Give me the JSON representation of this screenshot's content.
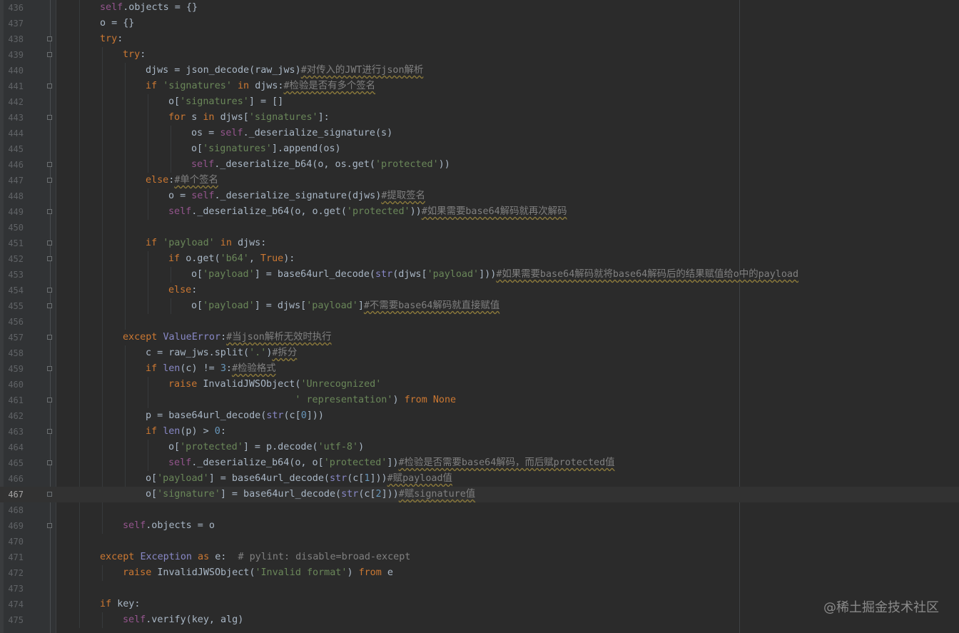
{
  "theme": {
    "background": "#2b2b2b",
    "gutter": "#313335",
    "keyword": "#cc7832",
    "string": "#6a8759",
    "number": "#6897bb",
    "comment": "#808080",
    "self": "#94558d",
    "builtin_class": "#8888c6",
    "text": "#a9b7c6"
  },
  "editor": {
    "current_line": "467",
    "lines": [
      {
        "num": "436",
        "indent": 2,
        "fold": false,
        "tokens": [
          [
            "self",
            "self"
          ],
          [
            "",
            ".objects = {}"
          ]
        ]
      },
      {
        "num": "437",
        "indent": 2,
        "fold": false,
        "tokens": [
          [
            "",
            "o = {}"
          ]
        ]
      },
      {
        "num": "438",
        "indent": 2,
        "fold": true,
        "tokens": [
          [
            "k",
            "try"
          ],
          [
            "",
            ":"
          ]
        ]
      },
      {
        "num": "439",
        "indent": 3,
        "fold": true,
        "tokens": [
          [
            "k",
            "try"
          ],
          [
            "",
            ":"
          ]
        ]
      },
      {
        "num": "440",
        "indent": 4,
        "fold": false,
        "tokens": [
          [
            "",
            "djws = json_decode(raw_jws)"
          ],
          [
            "cz",
            "#对传入的JWT进行json解析"
          ]
        ]
      },
      {
        "num": "441",
        "indent": 4,
        "fold": true,
        "tokens": [
          [
            "k",
            "if "
          ],
          [
            "s",
            "'signatures'"
          ],
          [
            "k",
            " in "
          ],
          [
            "",
            "djws:"
          ],
          [
            "cz",
            "#检验是否有多个签名"
          ]
        ]
      },
      {
        "num": "442",
        "indent": 5,
        "fold": false,
        "tokens": [
          [
            "",
            "o["
          ],
          [
            "s",
            "'signatures'"
          ],
          [
            "",
            "] = []"
          ]
        ]
      },
      {
        "num": "443",
        "indent": 5,
        "fold": true,
        "tokens": [
          [
            "k",
            "for "
          ],
          [
            "",
            "s "
          ],
          [
            "k",
            "in "
          ],
          [
            "",
            "djws["
          ],
          [
            "s",
            "'signatures'"
          ],
          [
            "",
            "]:"
          ]
        ]
      },
      {
        "num": "444",
        "indent": 6,
        "fold": false,
        "tokens": [
          [
            "",
            "os = "
          ],
          [
            "self",
            "self"
          ],
          [
            "",
            "._deserialize_signature(s)"
          ]
        ]
      },
      {
        "num": "445",
        "indent": 6,
        "fold": false,
        "tokens": [
          [
            "",
            "o["
          ],
          [
            "s",
            "'signatures'"
          ],
          [
            "",
            "].append(os)"
          ]
        ]
      },
      {
        "num": "446",
        "indent": 6,
        "fold": true,
        "tokens": [
          [
            "self",
            "self"
          ],
          [
            "",
            "._deserialize_b64(o, os.get("
          ],
          [
            "s",
            "'protected'"
          ],
          [
            "",
            "))"
          ]
        ]
      },
      {
        "num": "447",
        "indent": 4,
        "fold": true,
        "tokens": [
          [
            "k",
            "else"
          ],
          [
            "",
            ":"
          ],
          [
            "cz",
            "#单个签名"
          ]
        ]
      },
      {
        "num": "448",
        "indent": 5,
        "fold": false,
        "tokens": [
          [
            "",
            "o = "
          ],
          [
            "self",
            "self"
          ],
          [
            "",
            "._deserialize_signature(djws)"
          ],
          [
            "cz",
            "#提取签名"
          ]
        ]
      },
      {
        "num": "449",
        "indent": 5,
        "fold": true,
        "tokens": [
          [
            "self",
            "self"
          ],
          [
            "",
            "._deserialize_b64(o, o.get("
          ],
          [
            "s",
            "'protected'"
          ],
          [
            "",
            "))"
          ],
          [
            "cz",
            "#如果需要base64解码就再次解码"
          ]
        ]
      },
      {
        "num": "450",
        "indent": 4,
        "fold": false,
        "tokens": []
      },
      {
        "num": "451",
        "indent": 4,
        "fold": true,
        "tokens": [
          [
            "k",
            "if "
          ],
          [
            "s",
            "'payload'"
          ],
          [
            "k",
            " in "
          ],
          [
            "",
            "djws:"
          ]
        ]
      },
      {
        "num": "452",
        "indent": 5,
        "fold": true,
        "tokens": [
          [
            "k",
            "if "
          ],
          [
            "",
            "o.get("
          ],
          [
            "s",
            "'b64'"
          ],
          [
            "",
            ", "
          ],
          [
            "k",
            "True"
          ],
          [
            "",
            "):"
          ]
        ]
      },
      {
        "num": "453",
        "indent": 6,
        "fold": false,
        "tokens": [
          [
            "",
            "o["
          ],
          [
            "s",
            "'payload'"
          ],
          [
            "",
            "] = base64url_decode("
          ],
          [
            "cls",
            "str"
          ],
          [
            "",
            "(djws["
          ],
          [
            "s",
            "'payload'"
          ],
          [
            "",
            "]))"
          ],
          [
            "cz",
            "#如果需要base64解码就将base64解码后的结果赋值给o中的payload"
          ]
        ]
      },
      {
        "num": "454",
        "indent": 5,
        "fold": true,
        "tokens": [
          [
            "k",
            "else"
          ],
          [
            "",
            ":"
          ]
        ]
      },
      {
        "num": "455",
        "indent": 6,
        "fold": true,
        "tokens": [
          [
            "",
            "o["
          ],
          [
            "s",
            "'payload'"
          ],
          [
            "",
            "] = djws["
          ],
          [
            "s",
            "'payload'"
          ],
          [
            "",
            "]"
          ],
          [
            "cz",
            "#不需要base64解码就直接赋值"
          ]
        ]
      },
      {
        "num": "456",
        "indent": 4,
        "fold": false,
        "tokens": []
      },
      {
        "num": "457",
        "indent": 3,
        "fold": true,
        "tokens": [
          [
            "k",
            "except "
          ],
          [
            "cls",
            "ValueError"
          ],
          [
            "",
            ":"
          ],
          [
            "cz",
            "#当json解析无效时执行"
          ]
        ]
      },
      {
        "num": "458",
        "indent": 4,
        "fold": false,
        "tokens": [
          [
            "",
            "c = raw_jws.split("
          ],
          [
            "s",
            "'.'"
          ],
          [
            "",
            ")"
          ],
          [
            "cz",
            "#拆分"
          ]
        ]
      },
      {
        "num": "459",
        "indent": 4,
        "fold": true,
        "tokens": [
          [
            "k",
            "if "
          ],
          [
            "cls",
            "len"
          ],
          [
            "",
            "(c) != "
          ],
          [
            "n",
            "3"
          ],
          [
            "",
            ":"
          ],
          [
            "cz",
            "#检验格式"
          ]
        ]
      },
      {
        "num": "460",
        "indent": 5,
        "fold": false,
        "tokens": [
          [
            "k",
            "raise "
          ],
          [
            "",
            "InvalidJWSObject("
          ],
          [
            "s",
            "'Unrecognized'"
          ]
        ]
      },
      {
        "num": "461",
        "indent": 5,
        "fold": true,
        "tokens": [
          [
            "",
            "                      "
          ],
          [
            "s",
            "' representation'"
          ],
          [
            "",
            ") "
          ],
          [
            "k",
            "from None"
          ]
        ]
      },
      {
        "num": "462",
        "indent": 4,
        "fold": false,
        "tokens": [
          [
            "",
            "p = base64url_decode("
          ],
          [
            "cls",
            "str"
          ],
          [
            "",
            "(c["
          ],
          [
            "n",
            "0"
          ],
          [
            "",
            "]))"
          ]
        ]
      },
      {
        "num": "463",
        "indent": 4,
        "fold": true,
        "tokens": [
          [
            "k",
            "if "
          ],
          [
            "cls",
            "len"
          ],
          [
            "",
            "(p) > "
          ],
          [
            "n",
            "0"
          ],
          [
            "",
            ":"
          ]
        ]
      },
      {
        "num": "464",
        "indent": 5,
        "fold": false,
        "tokens": [
          [
            "",
            "o["
          ],
          [
            "s",
            "'protected'"
          ],
          [
            "",
            "] = p.decode("
          ],
          [
            "s",
            "'utf-8'"
          ],
          [
            "",
            ")"
          ]
        ]
      },
      {
        "num": "465",
        "indent": 5,
        "fold": true,
        "tokens": [
          [
            "self",
            "self"
          ],
          [
            "",
            "._deserialize_b64(o, o["
          ],
          [
            "s",
            "'protected'"
          ],
          [
            "",
            "])"
          ],
          [
            "cz",
            "#检验是否需要base64解码，而后赋protected值"
          ]
        ]
      },
      {
        "num": "466",
        "indent": 4,
        "fold": false,
        "tokens": [
          [
            "",
            "o["
          ],
          [
            "s",
            "'payload'"
          ],
          [
            "",
            "] = base64url_decode("
          ],
          [
            "cls",
            "str"
          ],
          [
            "",
            "(c["
          ],
          [
            "n",
            "1"
          ],
          [
            "",
            "]))"
          ],
          [
            "cz",
            "#赋payload值"
          ]
        ]
      },
      {
        "num": "467",
        "indent": 4,
        "fold": true,
        "tokens": [
          [
            "",
            "o["
          ],
          [
            "s",
            "'signature'"
          ],
          [
            "",
            "] = base64url_decode("
          ],
          [
            "cls",
            "str"
          ],
          [
            "",
            "(c["
          ],
          [
            "n",
            "2"
          ],
          [
            "",
            "]))"
          ],
          [
            "cz",
            "#赋signature值"
          ]
        ]
      },
      {
        "num": "468",
        "indent": 3,
        "fold": false,
        "tokens": []
      },
      {
        "num": "469",
        "indent": 3,
        "fold": true,
        "tokens": [
          [
            "self",
            "self"
          ],
          [
            "",
            ".objects = o"
          ]
        ]
      },
      {
        "num": "470",
        "indent": 2,
        "fold": false,
        "tokens": []
      },
      {
        "num": "471",
        "indent": 2,
        "fold": false,
        "tokens": [
          [
            "k",
            "except "
          ],
          [
            "cls",
            "Exception"
          ],
          [
            "k",
            " as "
          ],
          [
            "",
            "e:  "
          ],
          [
            "c",
            "# pylint: disable=broad-except"
          ]
        ]
      },
      {
        "num": "472",
        "indent": 3,
        "fold": false,
        "tokens": [
          [
            "k",
            "raise "
          ],
          [
            "",
            "InvalidJWSObject("
          ],
          [
            "s",
            "'Invalid format'"
          ],
          [
            "",
            ") "
          ],
          [
            "k",
            "from "
          ],
          [
            "",
            "e"
          ]
        ]
      },
      {
        "num": "473",
        "indent": 2,
        "fold": false,
        "tokens": []
      },
      {
        "num": "474",
        "indent": 2,
        "fold": false,
        "tokens": [
          [
            "k",
            "if "
          ],
          [
            "",
            "key:"
          ]
        ]
      },
      {
        "num": "475",
        "indent": 3,
        "fold": false,
        "tokens": [
          [
            "self",
            "self"
          ],
          [
            "",
            ".verify(key, alg)"
          ]
        ]
      }
    ]
  },
  "watermark": "@稀土掘金技术社区"
}
